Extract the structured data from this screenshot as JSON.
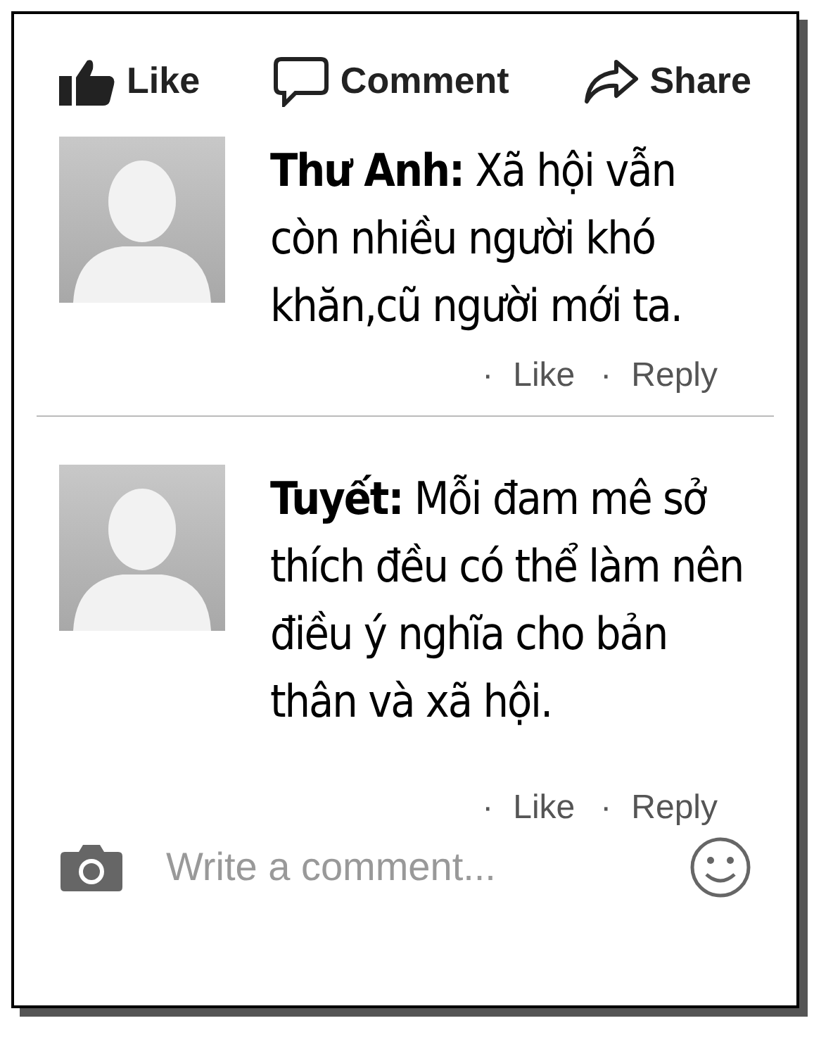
{
  "actions": [
    {
      "kind": "like",
      "label": "Like"
    },
    {
      "kind": "comment",
      "label": "Comment"
    },
    {
      "kind": "share",
      "label": "Share"
    }
  ],
  "comments": [
    {
      "author": "Thư Anh:",
      "text": "Xã hội vẫn còn nhiều người khó khăn,cũ người mới ta.",
      "links": [
        {
          "dot": "·",
          "label": "Like"
        },
        {
          "dot": "·",
          "label": "Reply"
        }
      ]
    },
    {
      "author": "Tuyết:",
      "text": "Mỗi đam mê sở thích đều có thể làm nên điều ý nghĩa cho bản thân và xã hội.",
      "links": [
        {
          "dot": "·",
          "label": "Like"
        },
        {
          "dot": "·",
          "label": "Reply"
        }
      ]
    }
  ],
  "composer": {
    "placeholder": "Write a comment..."
  }
}
